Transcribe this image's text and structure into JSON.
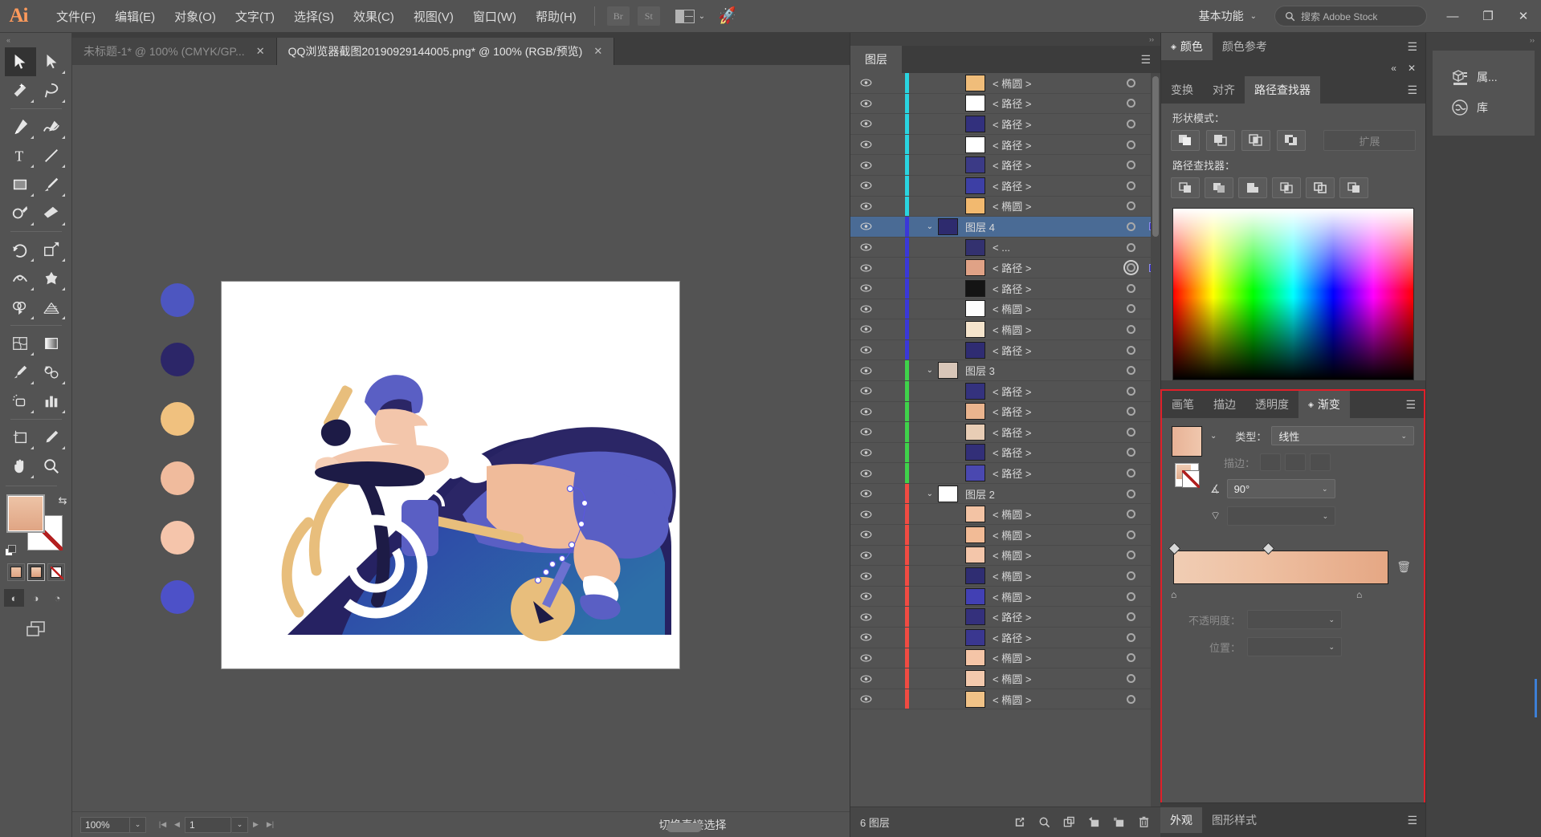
{
  "app": {
    "logo": "Ai"
  },
  "menubar": {
    "items": [
      "文件(F)",
      "编辑(E)",
      "对象(O)",
      "文字(T)",
      "选择(S)",
      "效果(C)",
      "视图(V)",
      "窗口(W)",
      "帮助(H)"
    ],
    "bridge_label": "Br",
    "stock_label": "St",
    "arrange_icon": "document-arrange-icon",
    "rocket_icon": "rocket-icon",
    "workspace": "基本功能",
    "search_placeholder": "搜索 Adobe Stock",
    "search_icon": "search-icon",
    "minimize": "—",
    "maximize": "❐",
    "close": "✕"
  },
  "toolbar": {
    "tools": [
      {
        "name": "selection-tool",
        "active": true
      },
      {
        "name": "direct-selection-tool",
        "active": false
      },
      {
        "name": "magic-wand-tool",
        "active": false
      },
      {
        "name": "lasso-tool",
        "active": false
      },
      {
        "name": "pen-tool",
        "active": false
      },
      {
        "name": "curvature-tool",
        "active": false
      },
      {
        "name": "type-tool",
        "active": false
      },
      {
        "name": "line-segment-tool",
        "active": false
      },
      {
        "name": "rectangle-tool",
        "active": false
      },
      {
        "name": "paintbrush-tool",
        "active": false
      },
      {
        "name": "shaper-tool",
        "active": false
      },
      {
        "name": "eraser-tool",
        "active": false
      },
      {
        "name": "rotate-tool",
        "active": false
      },
      {
        "name": "scale-tool",
        "active": false
      },
      {
        "name": "width-tool",
        "active": false
      },
      {
        "name": "free-transform-tool",
        "active": false
      },
      {
        "name": "shape-builder-tool",
        "active": false
      },
      {
        "name": "perspective-grid-tool",
        "active": false
      },
      {
        "name": "mesh-tool",
        "active": false
      },
      {
        "name": "gradient-tool",
        "active": false
      },
      {
        "name": "eyedropper-tool",
        "active": false
      },
      {
        "name": "blend-tool",
        "active": false
      },
      {
        "name": "symbol-sprayer-tool",
        "active": false
      },
      {
        "name": "column-graph-tool",
        "active": false
      },
      {
        "name": "artboard-tool",
        "active": false
      },
      {
        "name": "slice-tool",
        "active": false
      },
      {
        "name": "hand-tool",
        "active": false
      },
      {
        "name": "zoom-tool",
        "active": false
      }
    ],
    "fill_color": "#e8bb9d",
    "stroke_color": "#ffffff",
    "swap_icon": "swap-fill-stroke-icon",
    "default_icon": "default-fill-stroke-icon",
    "paint_modes": [
      "color-mode",
      "gradient-mode",
      "none-mode"
    ],
    "draw_modes": [
      "draw-normal",
      "draw-behind",
      "draw-inside"
    ],
    "screen_mode": "change-screen-mode"
  },
  "tabs": [
    {
      "title": "未标题-1* @ 100% (CMYK/GP...",
      "active": false,
      "close": "✕"
    },
    {
      "title": "QQ浏览器截图20190929144005.png* @ 100% (RGB/预览)",
      "active": true,
      "close": "✕"
    }
  ],
  "canvas": {
    "swatches": [
      "#4d56c0",
      "#2c2668",
      "#f0c17f",
      "#f0bb9d",
      "#f5c5ab",
      "#4d51c8"
    ],
    "artboard_bg": "#ffffff",
    "illustration": "cyclist-on-bicycle-illustration"
  },
  "statusbar": {
    "zoom": "100%",
    "zoom_caret": "⌄",
    "first_icon": "first-artboard-icon",
    "prev_icon": "prev-artboard-icon",
    "artboard_number": "1",
    "artboard_caret": "⌄",
    "next_icon": "next-artboard-icon",
    "last_icon": "last-artboard-icon",
    "status_text": "切换直接选择",
    "play_icon": "▶",
    "left_arrow": "‹",
    "right_arrow": "›"
  },
  "layers_panel": {
    "tab": "图层",
    "menu_icon": "panel-menu-icon",
    "footer_count": "6 图层",
    "footer_icons": [
      "make-clipping-mask-icon",
      "locate-object-icon",
      "create-new-sublayer-icon",
      "create-new-layer-icon",
      "duplicate-layer-icon",
      "delete-selection-icon"
    ],
    "rows": [
      {
        "name": "< 椭圆 >",
        "color": "#29d4e0",
        "kind": "item",
        "thumb": "#f0bd7a",
        "selected": false,
        "target": "ring"
      },
      {
        "name": "< 路径 >",
        "color": "#29d4e0",
        "kind": "item",
        "thumb": "#ffffff",
        "selected": false,
        "target": "ring"
      },
      {
        "name": "< 路径 >",
        "color": "#29d4e0",
        "kind": "item",
        "thumb": "#32307d",
        "selected": false,
        "target": "ring"
      },
      {
        "name": "< 路径 >",
        "color": "#29d4e0",
        "kind": "item",
        "thumb": "#ffffff",
        "selected": false,
        "target": "ring"
      },
      {
        "name": "< 路径 >",
        "color": "#29d4e0",
        "kind": "item",
        "thumb": "#3b3a86",
        "selected": false,
        "target": "ring"
      },
      {
        "name": "< 路径 >",
        "color": "#29d4e0",
        "kind": "item",
        "thumb": "#3d3fa5",
        "selected": false,
        "target": "ring"
      },
      {
        "name": "< 椭圆 >",
        "color": "#29d4e0",
        "kind": "item",
        "thumb": "#f2b96f",
        "selected": false,
        "target": "ring"
      },
      {
        "name": "图层 4",
        "color": "#3a38d8",
        "kind": "layer",
        "thumb": "#2e2b6e",
        "selected": true,
        "target": "ring",
        "has_selbox": true,
        "caret": "⌄"
      },
      {
        "name": "< ...",
        "color": "#3a38d8",
        "kind": "item",
        "thumb": "#33316f",
        "selected": false,
        "target": "ring"
      },
      {
        "name": "< 路径 >",
        "color": "#3a38d8",
        "kind": "item",
        "thumb": "#e0a286",
        "selected": false,
        "target": "ring-double",
        "has_selbox": true
      },
      {
        "name": "< 路径 >",
        "color": "#3a38d8",
        "kind": "item",
        "thumb": "#141414",
        "selected": false,
        "target": "ring"
      },
      {
        "name": "< 椭圆 >",
        "color": "#3a38d8",
        "kind": "item",
        "thumb": "#fdfdfd",
        "selected": false,
        "target": "ring"
      },
      {
        "name": "< 椭圆 >",
        "color": "#3a38d8",
        "kind": "item",
        "thumb": "#f5e4cc",
        "selected": false,
        "target": "ring"
      },
      {
        "name": "< 路径 >",
        "color": "#3a38d8",
        "kind": "item",
        "thumb": "#2f2c72",
        "selected": false,
        "target": "ring"
      },
      {
        "name": "图层 3",
        "color": "#3fd24a",
        "kind": "layer",
        "thumb": "#d8c6b8",
        "selected": false,
        "target": "ring",
        "caret": "⌄"
      },
      {
        "name": "< 路径 >",
        "color": "#3fd24a",
        "kind": "item",
        "thumb": "#34327e",
        "selected": false,
        "target": "ring"
      },
      {
        "name": "< 路径 >",
        "color": "#3fd24a",
        "kind": "item",
        "thumb": "#eab48e",
        "selected": false,
        "target": "ring"
      },
      {
        "name": "< 路径 >",
        "color": "#3fd24a",
        "kind": "item",
        "thumb": "#e8cdb5",
        "selected": false,
        "target": "ring"
      },
      {
        "name": "< 路径 >",
        "color": "#3fd24a",
        "kind": "item",
        "thumb": "#322f78",
        "selected": false,
        "target": "ring"
      },
      {
        "name": "< 路径 >",
        "color": "#3fd24a",
        "kind": "item",
        "thumb": "#4a48b0",
        "selected": false,
        "target": "ring"
      },
      {
        "name": "图层 2",
        "color": "#f04b42",
        "kind": "layer",
        "thumb": "#ffffff",
        "selected": false,
        "target": "ring",
        "caret": "⌄"
      },
      {
        "name": "< 椭圆 >",
        "color": "#f04b42",
        "kind": "item",
        "thumb": "#f3c3a4",
        "selected": false,
        "target": "ring"
      },
      {
        "name": "< 椭圆 >",
        "color": "#f04b42",
        "kind": "item",
        "thumb": "#f2bb96",
        "selected": false,
        "target": "ring"
      },
      {
        "name": "< 椭圆 >",
        "color": "#f04b42",
        "kind": "item",
        "thumb": "#f4c6aa",
        "selected": false,
        "target": "ring"
      },
      {
        "name": "< 椭圆 >",
        "color": "#f04b42",
        "kind": "item",
        "thumb": "#2f2d72",
        "selected": false,
        "target": "ring"
      },
      {
        "name": "< 椭圆 >",
        "color": "#f04b42",
        "kind": "item",
        "thumb": "#4240b4",
        "selected": false,
        "target": "ring"
      },
      {
        "name": "< 路径 >",
        "color": "#f04b42",
        "kind": "item",
        "thumb": "#34307c",
        "selected": false,
        "target": "ring"
      },
      {
        "name": "< 路径 >",
        "color": "#f04b42",
        "kind": "item",
        "thumb": "#3a3790",
        "selected": false,
        "target": "ring"
      },
      {
        "name": "< 椭圆 >",
        "color": "#f04b42",
        "kind": "item",
        "thumb": "#f5c5a7",
        "selected": false,
        "target": "ring"
      },
      {
        "name": "< 椭圆 >",
        "color": "#f04b42",
        "kind": "item",
        "thumb": "#f3c9ad",
        "selected": false,
        "target": "ring"
      },
      {
        "name": "< 椭圆 >",
        "color": "#f04b42",
        "kind": "item",
        "thumb": "#f0c287",
        "selected": false,
        "target": "ring"
      }
    ]
  },
  "color_panel": {
    "tabs": [
      "颜色",
      "颜色参考"
    ],
    "active_tab": "颜色",
    "menu_icon": "panel-menu-icon",
    "collapse_icon": "«",
    "close_icon": "✕"
  },
  "pathfinder_panel": {
    "tabs": [
      "变换",
      "对齐",
      "路径查找器"
    ],
    "active_tab": "路径查找器",
    "menu_icon": "panel-menu-icon",
    "shape_modes_label": "形状模式：",
    "shape_modes": [
      "unite-icon",
      "minus-front-icon",
      "intersect-icon",
      "exclude-icon"
    ],
    "expand_label": "扩展",
    "pathfinders_label": "路径查找器：",
    "pathfinders": [
      "divide-icon",
      "trim-icon",
      "merge-icon",
      "crop-icon",
      "outline-icon",
      "minus-back-icon"
    ]
  },
  "gradient_panel": {
    "tabs": [
      "画笔",
      "描边",
      "透明度",
      "渐变"
    ],
    "active_tab": "渐变",
    "menu_icon": "panel-menu-icon",
    "type_label": "类型：",
    "type_value": "线性",
    "stroke_label": "描边：",
    "angle_label": "angle-icon",
    "angle_value": "90°",
    "aspect_label": "aspect-ratio-icon",
    "aspect_value": "",
    "opacity_label": "不透明度：",
    "opacity_value": "",
    "position_label": "位置：",
    "position_value": "",
    "delete_icon": "delete-stop-icon",
    "gradient_start": "#f2cfb7",
    "gradient_end": "#e4a581",
    "highlight_border": "#e0202a"
  },
  "appearance_panel": {
    "tabs": [
      "外观",
      "图形样式"
    ],
    "active_tab": "外观",
    "menu_icon": "panel-menu-icon"
  },
  "icon_rail": {
    "items": [
      {
        "label": "属...",
        "icon": "properties-icon"
      },
      {
        "label": "库",
        "icon": "libraries-icon"
      }
    ]
  }
}
